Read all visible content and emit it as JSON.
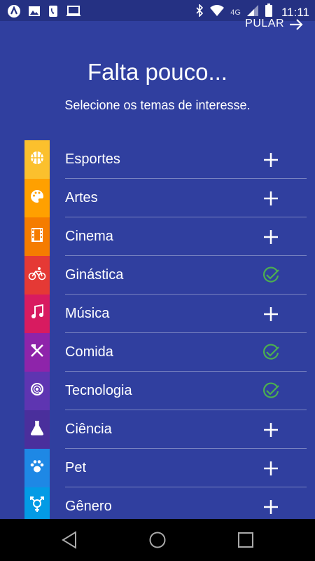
{
  "status_bar": {
    "time": "11:11",
    "network": "4G",
    "notification_icons": [
      "app-icon",
      "image-icon",
      "phone-icon",
      "laptop-icon"
    ]
  },
  "header": {
    "skip_label": "PULAR",
    "title": "Falta pouco...",
    "subtitle": "Selecione os temas de interesse."
  },
  "topics": [
    {
      "label": "Esportes",
      "icon": "basketball-icon",
      "color": "#fbc02d",
      "selected": false
    },
    {
      "label": "Artes",
      "icon": "palette-icon",
      "color": "#ffa000",
      "selected": false
    },
    {
      "label": "Cinema",
      "icon": "film-icon",
      "color": "#f57c00",
      "selected": false
    },
    {
      "label": "Ginástica",
      "icon": "bicycle-icon",
      "color": "#e53935",
      "selected": true
    },
    {
      "label": "Música",
      "icon": "music-note-icon",
      "color": "#d81b60",
      "selected": false
    },
    {
      "label": "Comida",
      "icon": "fork-knife-icon",
      "color": "#8e24aa",
      "selected": true
    },
    {
      "label": "Tecnologia",
      "icon": "at-sign-icon",
      "color": "#5e35b1",
      "selected": true
    },
    {
      "label": "Ciência",
      "icon": "flask-icon",
      "color": "#4a2f9c",
      "selected": false
    },
    {
      "label": "Pet",
      "icon": "paw-icon",
      "color": "#1e88e5",
      "selected": false
    },
    {
      "label": "Gênero",
      "icon": "gender-icon",
      "color": "#039be5",
      "selected": false
    }
  ],
  "colors": {
    "background": "#303f9f",
    "status_bar": "#253183",
    "check": "#4caf50",
    "plus": "#ffffff"
  }
}
